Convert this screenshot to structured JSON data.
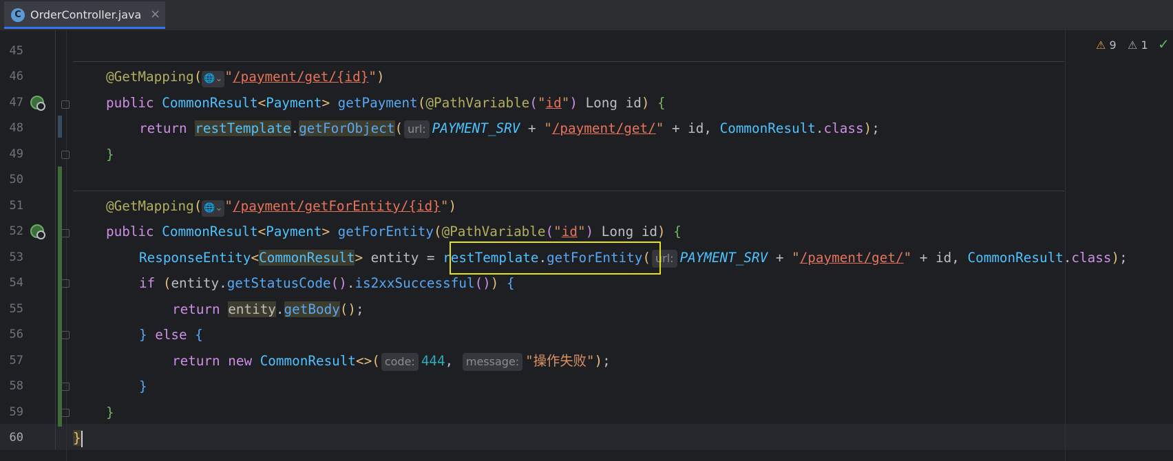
{
  "tab": {
    "icon_letter": "C",
    "title": "OrderController.java",
    "close": "×"
  },
  "status": {
    "warnings": "9",
    "weak_warnings": "1",
    "warn_icon": "⚠",
    "check_icon": "✓"
  },
  "code": {
    "l45": "45",
    "l46": "46",
    "l47": "47",
    "l48": "48",
    "l49": "49",
    "l50": "50",
    "l51": "51",
    "l52": "52",
    "l53": "53",
    "l54": "54",
    "l55": "55",
    "l56": "56",
    "l57": "57",
    "l58": "58",
    "l59": "59",
    "l60": "60",
    "annotation": "@GetMapping",
    "path1": "/payment/get/{id}",
    "path2": "/payment/getForEntity/{id}",
    "public": "public",
    "return": "return",
    "if": "if",
    "else": "else",
    "new": "new",
    "class": "class",
    "commonresult": "CommonResult",
    "payment": "Payment",
    "getpayment": "getPayment",
    "getforentity": "getForEntity",
    "pathvariable": "@PathVariable",
    "id_str": "id",
    "long": "Long",
    "id": "id",
    "resttemplate": "restTemplate",
    "getforobject": "getForObject",
    "getforentity_call": "getForEntity",
    "hint_url": "url:",
    "payment_srv": "PAYMENT_SRV",
    "path_get": "/payment/get/",
    "responseentity": "ResponseEntity",
    "entity": "entity",
    "getstatuscode": "getStatusCode",
    "is2xx": "is2xxSuccessful",
    "getbody": "getBody",
    "hint_code": "code:",
    "code_val": "444",
    "hint_message": "message:",
    "msg_val": "操作失败"
  }
}
